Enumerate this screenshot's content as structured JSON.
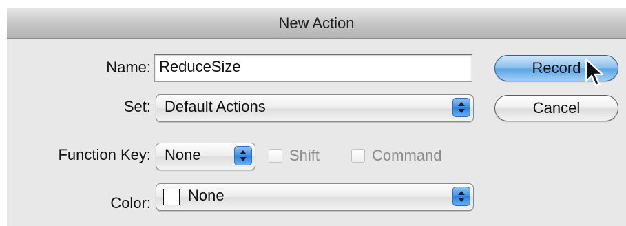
{
  "window": {
    "title": "New Action"
  },
  "form": {
    "name": {
      "label": "Name:",
      "value": "ReduceSize"
    },
    "set": {
      "label": "Set:",
      "value": "Default Actions"
    },
    "function_key": {
      "label": "Function Key:",
      "value": "None",
      "shift_label": "Shift",
      "shift_checked": false,
      "command_label": "Command",
      "command_checked": false
    },
    "color": {
      "label": "Color:",
      "value": "None",
      "swatch_color": "#ffffff"
    }
  },
  "buttons": {
    "record": "Record",
    "cancel": "Cancel"
  },
  "icons": {
    "popup_stepper": "updown-arrows-icon",
    "pointer": "mouse-pointer-icon"
  },
  "colors": {
    "default_button": "#8ec1ee",
    "stepper_accent": "#3b8ee6",
    "window_bg": "#e8e8e8"
  }
}
